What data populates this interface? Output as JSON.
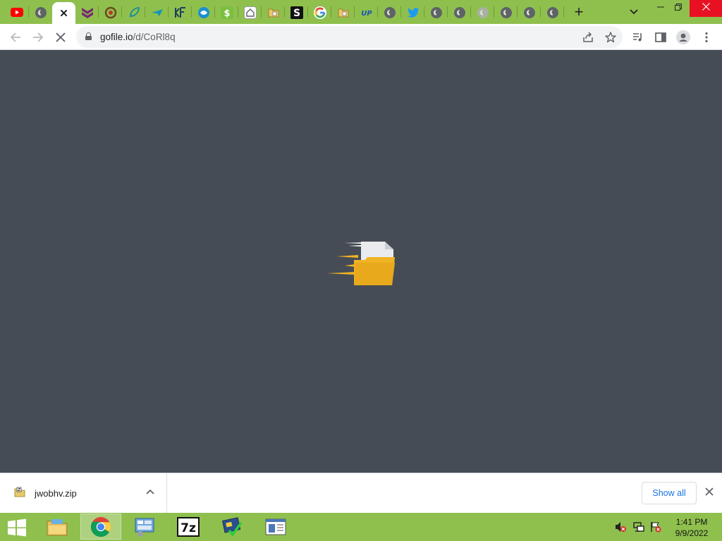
{
  "browser": {
    "tabs": [
      {
        "name": "YouTube",
        "icon": "youtube-icon"
      },
      {
        "name": "Web page",
        "icon": "globe-icon"
      },
      {
        "name": "Active tab",
        "icon": "close-icon",
        "active": true
      },
      {
        "name": "Tab",
        "icon": "chevron-logo-icon"
      },
      {
        "name": "Tab",
        "icon": "ring-logo-icon"
      },
      {
        "name": "Tab",
        "icon": "rocket-icon"
      },
      {
        "name": "Tab",
        "icon": "paper-plane-icon"
      },
      {
        "name": "Tab",
        "icon": "kf-logo-icon"
      },
      {
        "name": "Tab",
        "icon": "fish-logo-icon"
      },
      {
        "name": "Tab",
        "icon": "dollar-icon"
      },
      {
        "name": "Tab",
        "icon": "home-icon"
      },
      {
        "name": "Tab",
        "icon": "archive-icon"
      },
      {
        "name": "Tab",
        "icon": "s-logo-icon"
      },
      {
        "name": "Google",
        "icon": "google-icon"
      },
      {
        "name": "Tab",
        "icon": "archive-icon"
      },
      {
        "name": "Tab",
        "icon": "up-logo-icon"
      },
      {
        "name": "Tab",
        "icon": "globe-icon"
      },
      {
        "name": "Twitter",
        "icon": "twitter-icon"
      },
      {
        "name": "Tab",
        "icon": "globe-icon"
      },
      {
        "name": "Tab",
        "icon": "globe-icon"
      },
      {
        "name": "Tab",
        "icon": "globe-icon"
      },
      {
        "name": "Tab",
        "icon": "globe-icon"
      },
      {
        "name": "Tab",
        "icon": "globe-icon"
      },
      {
        "name": "Tab",
        "icon": "globe-icon"
      }
    ],
    "new_tab_label": "+",
    "url_host": "gofile.io",
    "url_path": "/d/CoRl8q"
  },
  "download_shelf": {
    "file_name": "jwobhv.zip",
    "show_all_label": "Show all"
  },
  "taskbar": {
    "time": "1:41 PM",
    "date": "9/9/2022"
  },
  "colors": {
    "tab_strip": "#8fc04e",
    "content_bg": "#464c55",
    "folder": "#f0b323",
    "link_blue": "#1a73e8"
  }
}
